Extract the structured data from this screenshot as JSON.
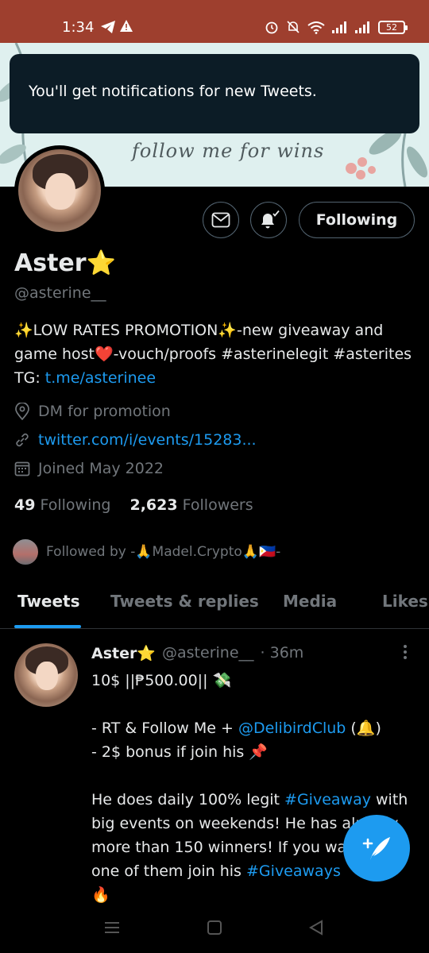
{
  "status_bar": {
    "time": "1:34",
    "battery": "52"
  },
  "banner": {
    "text": "follow me for wins"
  },
  "toast": {
    "message": "You'll get notifications for new Tweets."
  },
  "profile": {
    "name": "Aster⭐",
    "handle": "@asterine__",
    "bio_text": "✨LOW RATES PROMOTION✨-new giveaway and game host❤️-vouch/proofs #asterinelegit #asterites TG: ",
    "bio_link": "t.me/asterinee",
    "location": "DM for promotion",
    "website": "twitter.com/i/events/15283...",
    "joined": "Joined May 2022",
    "following_count": "49",
    "following_label": "Following",
    "followers_count": "2,623",
    "followers_label": "Followers",
    "followed_by": "Followed by -🙏Madel.Crypto🙏🇵🇭-",
    "follow_button": "Following"
  },
  "tabs": [
    {
      "label": "Tweets",
      "active": true
    },
    {
      "label": "Tweets & replies",
      "active": false
    },
    {
      "label": "Media",
      "active": false
    },
    {
      "label": "Likes",
      "active": false
    }
  ],
  "tweet": {
    "name": "Aster⭐",
    "handle": "@asterine__",
    "time": "· 36m",
    "line1": "10$ ||₱500.00|| 💸",
    "line2a": "- RT & Follow Me + ",
    "mention": "@DelibirdClub",
    "line2b": " (🔔)",
    "line3": "- 2$ bonus if join his 📌",
    "line4a": "He does daily 100% legit ",
    "hashtag1": "#Giveaway",
    "line4b": " with big events on weekends! He has already more than 150 winners! If you want be one of them join his ",
    "hashtag2": "#Giveaways",
    "line5": "🔥"
  },
  "colors": {
    "accent": "#1d9bf0",
    "status_bar": "#9e3f2e",
    "banner_bg": "#dff0ef"
  }
}
